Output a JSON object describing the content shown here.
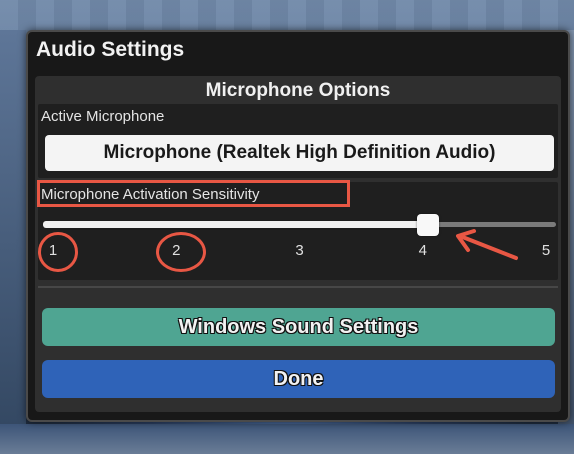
{
  "panel": {
    "title": "Audio Settings"
  },
  "microphone_options": {
    "header": "Microphone Options",
    "active_microphone_label": "Active Microphone",
    "active_microphone_value": "Microphone (Realtek High Definition Audio)"
  },
  "sensitivity": {
    "label": "Microphone Activation Sensitivity",
    "min": 1,
    "max": 5,
    "value": 4,
    "ticks": [
      "1",
      "2",
      "3",
      "4",
      "5"
    ]
  },
  "buttons": {
    "windows_sound_settings": "Windows Sound Settings",
    "done": "Done"
  },
  "colors": {
    "annotation": "#e85744",
    "windows_button": "#4fa592",
    "done_button": "#2f63b8"
  },
  "annotations": [
    {
      "type": "rectangle",
      "target": "sensitivity-label"
    },
    {
      "type": "circle",
      "target": "tick-1"
    },
    {
      "type": "circle",
      "target": "tick-2"
    },
    {
      "type": "arrow",
      "target": "slider-thumb"
    }
  ]
}
